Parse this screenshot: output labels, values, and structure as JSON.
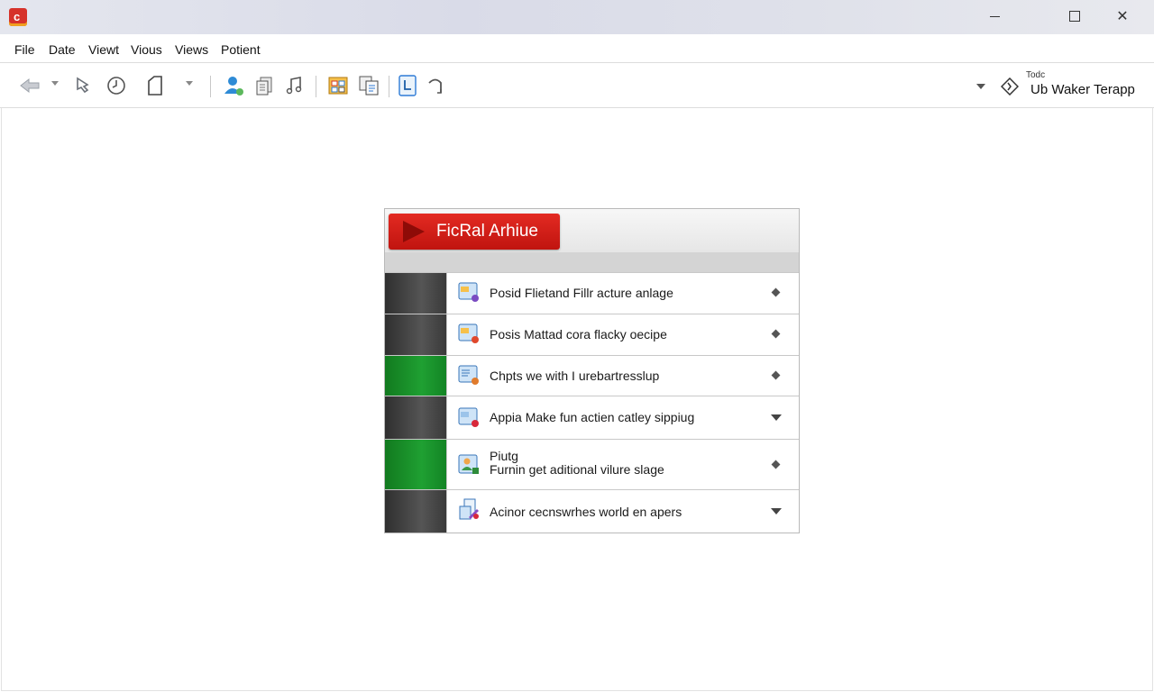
{
  "window": {
    "icon_glyph": "c",
    "controls": {
      "minimize": "minimize-icon",
      "maximize": "maximize-icon",
      "close": "✕"
    }
  },
  "menu": [
    "File",
    "Date",
    "Viewt",
    "Vious",
    "Views",
    "Potient"
  ],
  "toolbar": {
    "icons": [
      "back-arrow-icon",
      "cursor-icon",
      "clock-icon",
      "document-icon",
      "user-icon",
      "stack-icon",
      "music-note-icon",
      "folder-grid-icon",
      "copy-icon",
      "square-l-icon",
      "rotate-icon"
    ]
  },
  "profile": {
    "caption": "Todc",
    "name": "Ub Waker Terapp",
    "icon": "tag-icon"
  },
  "panel": {
    "title": "FicRal Arhiue",
    "rows": [
      {
        "text": "Posid Flietand Fillr acture anlage",
        "swatch": "dark",
        "indicator": "diamond",
        "icon": "app-window-icon"
      },
      {
        "text": "Posis Mattad cora flacky oecipe",
        "swatch": "dark",
        "indicator": "diamond",
        "icon": "app-window-icon"
      },
      {
        "text": "Chpts we with I urebartresslup",
        "swatch": "green",
        "indicator": "diamond",
        "icon": "app-window-icon"
      },
      {
        "text": "Appia Make fun actien catley sippiug",
        "swatch": "dark",
        "indicator": "chevron",
        "icon": "app-window-icon"
      },
      {
        "text": "Piutg",
        "text2": "Furnin get aditional vilure slage",
        "swatch": "green",
        "indicator": "diamond",
        "icon": "person-box-icon"
      },
      {
        "text": "Acinor cecnswrhes world en apers",
        "swatch": "dark",
        "indicator": "chevron",
        "icon": "document-edit-icon"
      }
    ]
  },
  "colors": {
    "title_red": "#d91c16",
    "swatch_green": "#1a9a2c",
    "swatch_dark": "#3e3e3e"
  }
}
